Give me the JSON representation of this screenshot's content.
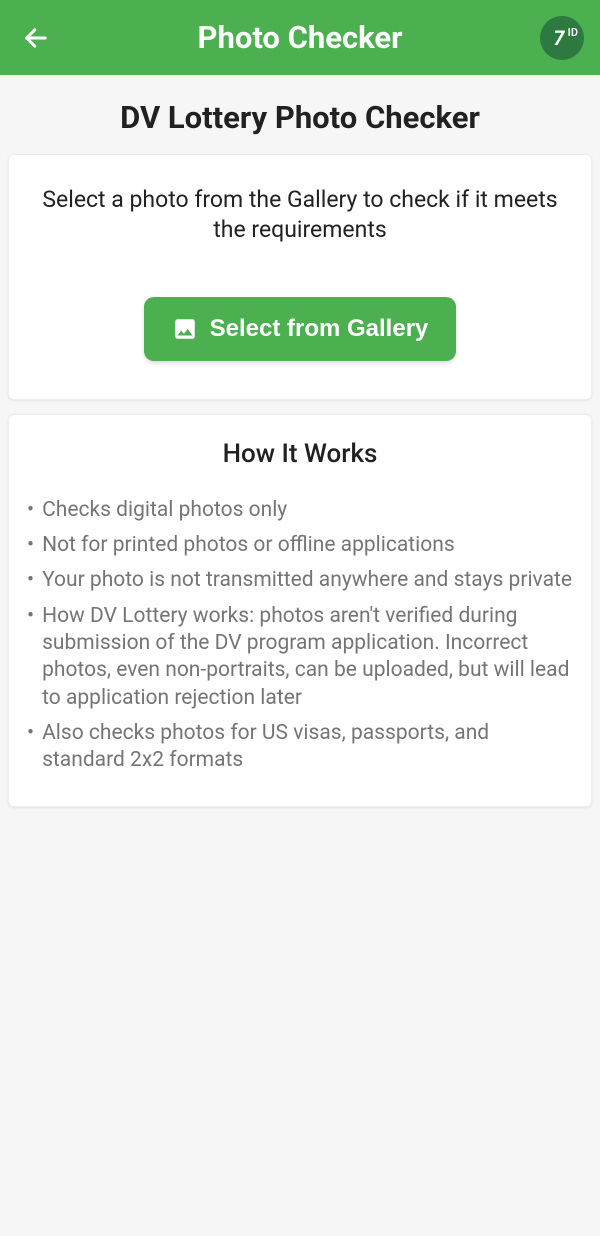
{
  "header": {
    "title": "Photo Checker",
    "logo_main": "7",
    "logo_sub": "ID"
  },
  "page_title": "DV Lottery Photo Checker",
  "instruction": {
    "text": "Select a photo from the Gallery to check if it meets the requirements",
    "button_label": "Select from Gallery"
  },
  "how": {
    "title": "How It Works",
    "items": [
      "Checks digital photos only",
      "Not for printed photos or offline applications",
      "Your photo is not transmitted anywhere and stays private",
      "How DV Lottery works: photos aren't verified during submission of the DV program application. Incorrect photos, even non-portraits, can be uploaded, but will lead to application rejection later",
      "Also checks photos for US visas, passports, and standard 2x2 formats"
    ]
  }
}
